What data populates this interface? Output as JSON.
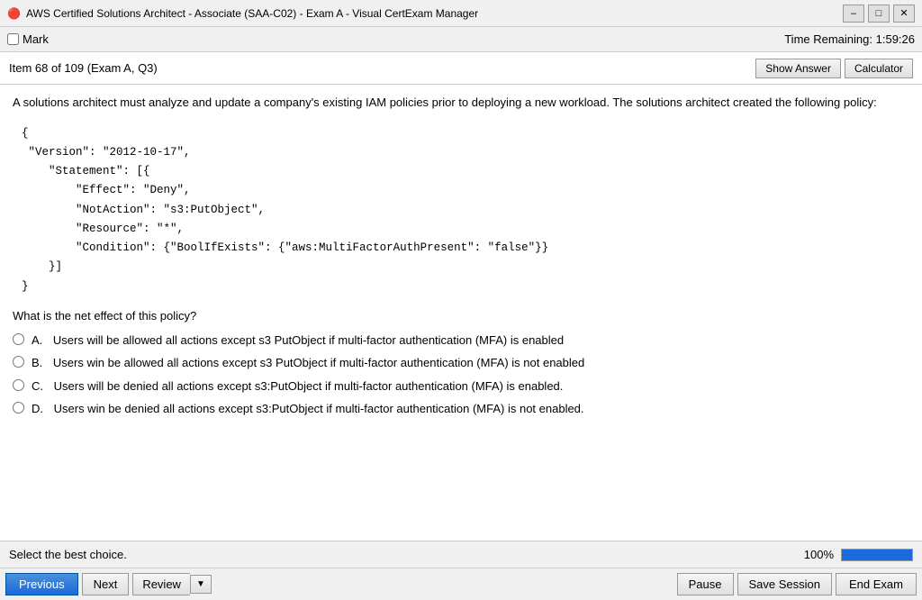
{
  "titleBar": {
    "icon": "🔴",
    "title": "AWS Certified Solutions Architect - Associate (SAA-C02) - Exam A - Visual CertExam Manager"
  },
  "menuBar": {
    "markLabel": "Mark",
    "timeLabel": "Time Remaining:",
    "timeValue": "1:59:26"
  },
  "header": {
    "itemInfo": "Item 68 of 109  (Exam A, Q3)",
    "showAnswerBtn": "Show Answer",
    "calculatorBtn": "Calculator"
  },
  "question": {
    "text": "A solutions architect must analyze and update a company's existing IAM policies prior to deploying a new workload. The solutions architect created the following policy:",
    "codeLines": [
      "{",
      "\"Version\": \"2012-10-17\",",
      "    \"Statement\": [{",
      "        \"Effect\": \"Deny\",",
      "        \"NotAction\": \"s3:PutObject\",",
      "        \"Resource\": \"*\",",
      "        \"Condition\": {\"BoolIfExists\": {\"aws:MultiFactorAuthPresent\": \"false\"}}",
      "    }]",
      "}"
    ],
    "netEffectLabel": "What is the net effect of this policy?",
    "options": [
      {
        "label": "A.",
        "text": "Users will be allowed all actions except s3 PutObject if multi-factor authentication (MFA) is enabled"
      },
      {
        "label": "B.",
        "text": "Users win be allowed all actions except s3 PutObject if multi-factor authentication (MFA) is not enabled"
      },
      {
        "label": "C.",
        "text": "Users will be denied all actions except s3:PutObject if multi-factor authentication (MFA) is enabled."
      },
      {
        "label": "D.",
        "text": "Users win be denied all actions except s3:PutObject if multi-factor authentication (MFA) is not enabled."
      }
    ]
  },
  "statusBar": {
    "selectText": "Select the best choice.",
    "progressPercent": "100%",
    "progressFill": 100
  },
  "toolbar": {
    "previousBtn": "Previous",
    "nextBtn": "Next",
    "reviewBtn": "Review",
    "pauseBtn": "Pause",
    "saveSessionBtn": "Save Session",
    "endExamBtn": "End Exam"
  }
}
